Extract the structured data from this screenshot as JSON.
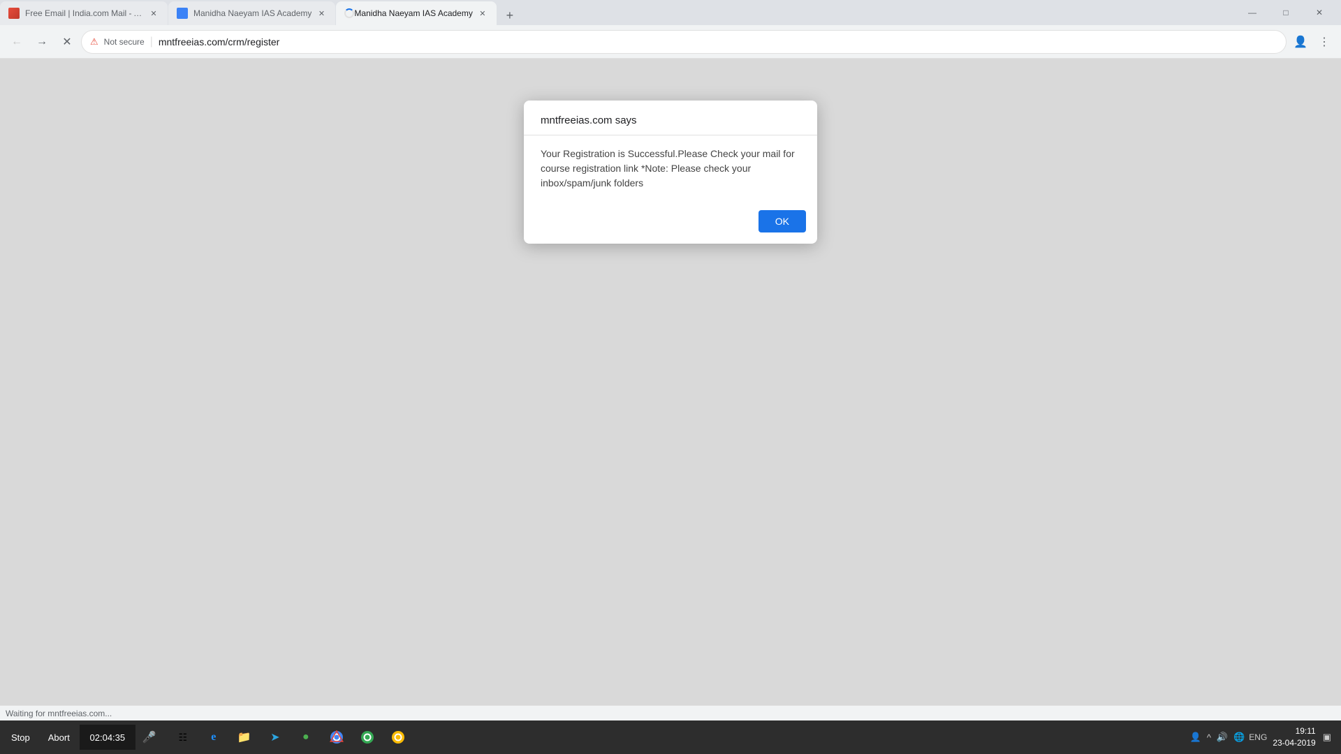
{
  "browser": {
    "tabs": [
      {
        "id": "tab1",
        "title": "Free Email | India.com Mail - An...",
        "active": false,
        "favicon": "mail"
      },
      {
        "id": "tab2",
        "title": "Manidha Naeyam IAS Academy",
        "active": false,
        "favicon": "ias"
      },
      {
        "id": "tab3",
        "title": "Manidha Naeyam IAS Academy",
        "active": true,
        "favicon": "ias",
        "loading": true
      }
    ],
    "url": "mntfreeias.com/crm/register",
    "security_label": "Not secure",
    "title_bar_controls": {
      "minimize": "—",
      "maximize": "□",
      "close": "✕"
    }
  },
  "dialog": {
    "title": "mntfreeias.com says",
    "message": "Your Registration is Successful.Please Check your mail for course registration link *Note: Please check your inbox/spam/junk folders",
    "ok_label": "OK"
  },
  "status_bar": {
    "text": "Waiting for mntfreeias.com..."
  },
  "taskbar": {
    "stop_label": "Stop",
    "abort_label": "Abort",
    "timer": "02:04:35",
    "time": "19:11",
    "date": "23-04-2019",
    "language": "ENG"
  }
}
